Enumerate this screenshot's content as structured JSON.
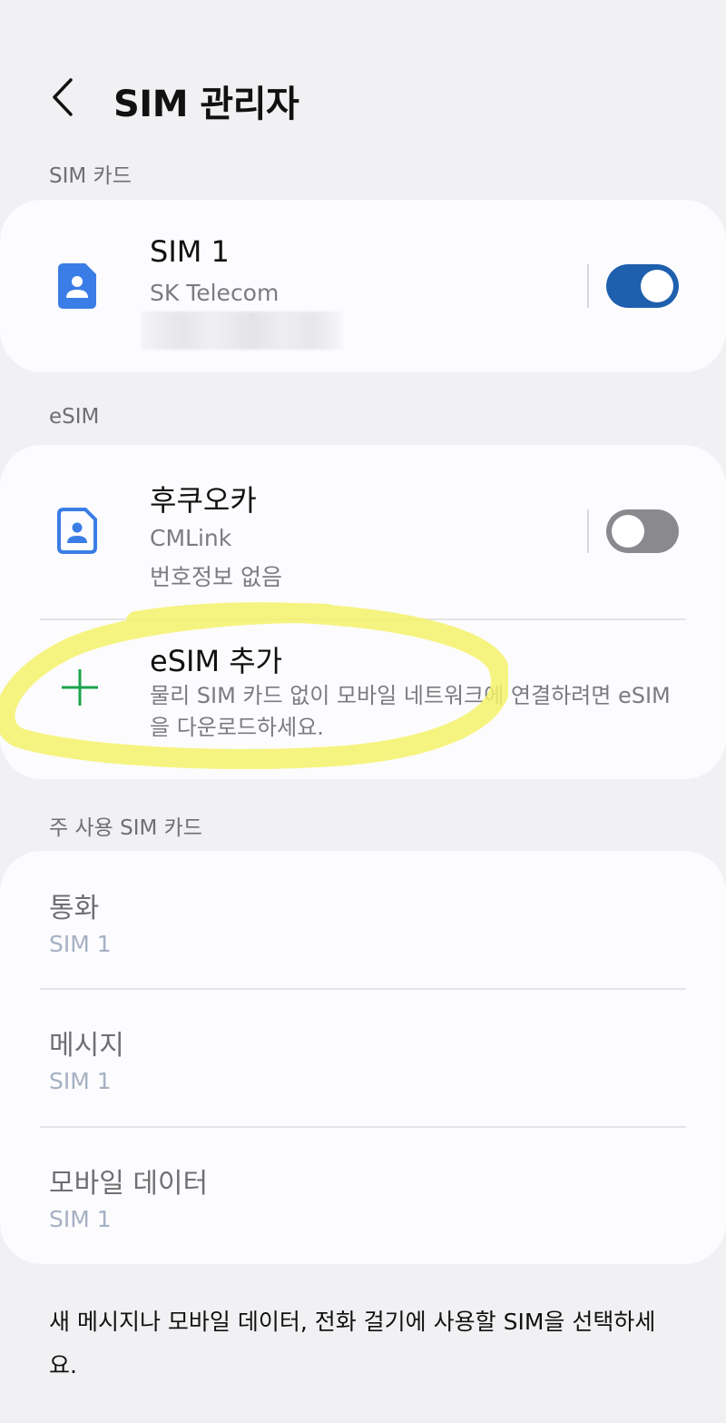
{
  "header": {
    "title": "SIM 관리자"
  },
  "sections": {
    "sim_card": "SIM 카드",
    "esim": "eSIM",
    "primary": "주 사용 SIM 카드"
  },
  "sim1": {
    "name": "SIM 1",
    "carrier": "SK Telecom",
    "enabled": true
  },
  "esim1": {
    "name": "후쿠오카",
    "carrier": "CMLink",
    "number": "번호정보 없음",
    "enabled": false
  },
  "add_esim": {
    "title": "eSIM 추가",
    "description": "물리 SIM 카드 없이 모바일 네트워크에 연결하려면 eSIM을 다운로드하세요."
  },
  "preferences": [
    {
      "title": "통화",
      "value": "SIM 1"
    },
    {
      "title": "메시지",
      "value": "SIM 1"
    },
    {
      "title": "모바일 데이터",
      "value": "SIM 1"
    }
  ],
  "footer": "새 메시지나 모바일 데이터, 전화 걸기에 사용할 SIM을 선택하세요.",
  "colors": {
    "accent": "#1e5fae",
    "icon_blue": "#3b7de6",
    "plus_green": "#1aa34a",
    "highlight": "#f5f26a"
  }
}
